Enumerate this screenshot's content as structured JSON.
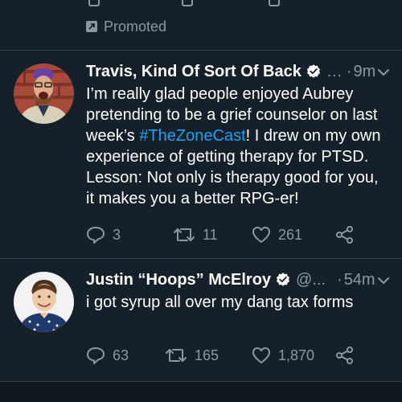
{
  "promoted": {
    "label": "Promoted",
    "icon": "promoted-arrow-icon"
  },
  "tweets": [
    {
      "display_name": "Travis, Kind Of Sort Of Back",
      "handle": "…",
      "dot": "·",
      "time": "9m",
      "text_before": "I’m really glad people enjoyed Aubrey pretending to be a grief counselor on last week’s ",
      "hashtag": "#TheZoneCast",
      "text_after": "! I drew on my own experience of getting therapy for PTSD. Lesson: Not only is therapy good for you, it makes you a better RPG-er!",
      "replies": "3",
      "retweets": "11",
      "likes": "261"
    },
    {
      "display_name": "Justin “Hoops” McElroy",
      "handle": "@...",
      "dot": "·",
      "time": "54m",
      "text": "i got syrup all over my dang tax forms",
      "replies": "63",
      "retweets": "165",
      "likes": "1,870"
    }
  ],
  "colors": {
    "background": "#15202b",
    "secondary_text": "#8899a6",
    "hashtag": "#1da1f2",
    "verified": "#ffffff",
    "divider": "#38444d"
  }
}
